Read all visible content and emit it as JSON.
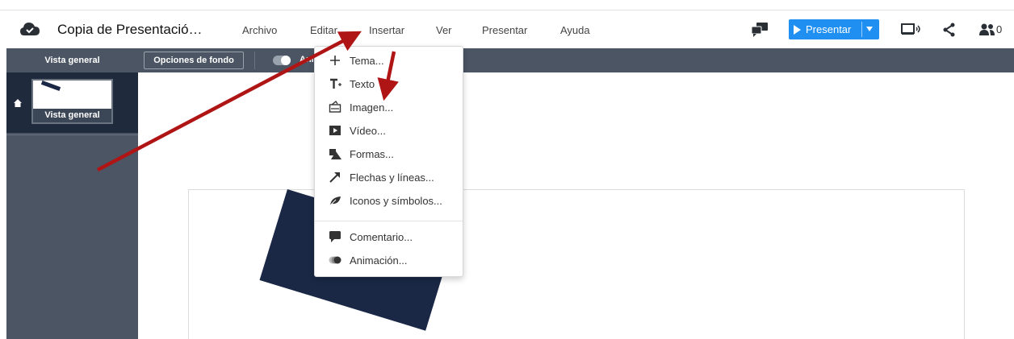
{
  "colors": {
    "accent": "#1f8ff2",
    "toolbar_bg": "#4b5563",
    "slide_shape": "#1a2845",
    "annotation_arrow": "#b01515"
  },
  "header": {
    "title": "Copia de Presentació…",
    "menu": [
      "Archivo",
      "Editar",
      "Insertar",
      "Ver",
      "Presentar",
      "Ayuda"
    ],
    "present_label": "Presentar",
    "collaborators_count": "0"
  },
  "toolbar": {
    "overview_label": "Vista general",
    "background_options_label": "Opciones de fondo",
    "animation_label_partial": "Ani"
  },
  "sidebar": {
    "thumbnail_label": "Vista general"
  },
  "insert_menu": {
    "items": [
      {
        "icon": "plus-icon",
        "label": "Tema..."
      },
      {
        "icon": "text-icon",
        "label": "Texto"
      },
      {
        "icon": "image-icon",
        "label": "Imagen..."
      },
      {
        "icon": "video-icon",
        "label": "Vídeo..."
      },
      {
        "icon": "shapes-icon",
        "label": "Formas..."
      },
      {
        "icon": "arrow-icon",
        "label": "Flechas y líneas..."
      },
      {
        "icon": "leaf-icon",
        "label": "Iconos y símbolos..."
      },
      {
        "icon": "comment-icon",
        "label": "Comentario..."
      },
      {
        "icon": "animation-icon",
        "label": "Animación..."
      }
    ]
  }
}
